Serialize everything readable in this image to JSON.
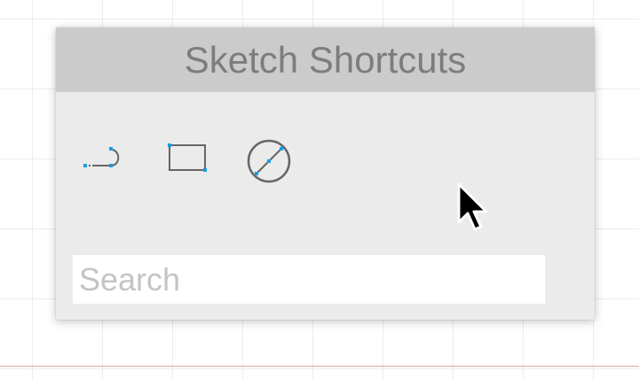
{
  "panel": {
    "title": "Sketch Shortcuts"
  },
  "tools": [
    {
      "name": "vector",
      "icon": "vector-path-icon"
    },
    {
      "name": "rectangle",
      "icon": "rectangle-icon"
    },
    {
      "name": "oval",
      "icon": "oval-icon"
    }
  ],
  "search": {
    "value": "",
    "placeholder": "Search"
  },
  "colors": {
    "accent": "#1a9be6",
    "header_bg": "#cbcbcb",
    "panel_bg": "#ebebeb",
    "title_text": "#7d7d7d",
    "guide_line": "#e8a3a3"
  }
}
